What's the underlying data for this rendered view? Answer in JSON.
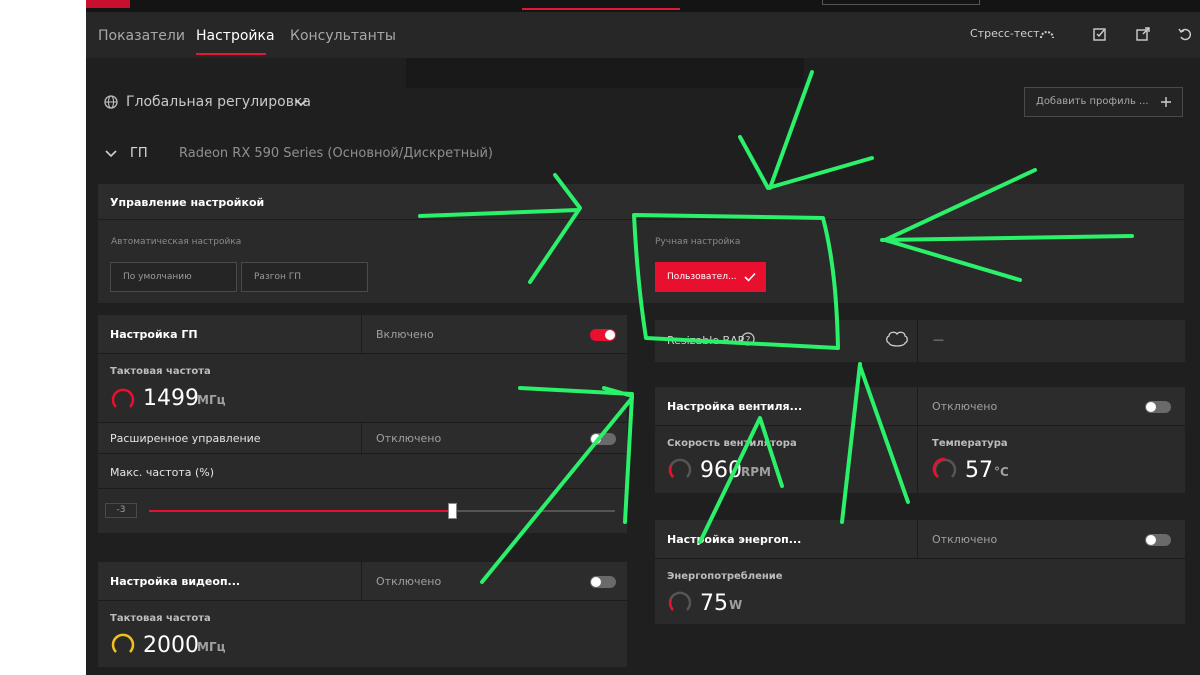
{
  "nav": {
    "tabs": [
      {
        "label": "Показатели"
      },
      {
        "label": "Настройка"
      },
      {
        "label": "Консультанты"
      }
    ],
    "stress_test": "Стресс-тест"
  },
  "global": {
    "label": "Глобальная регулировка",
    "add_profile": "Добавить профиль ..."
  },
  "gpu": {
    "section": "ГП",
    "name": "Radeon RX 590 Series (Основной/Дискретный)"
  },
  "tuning_control": {
    "title": "Управление настройкой",
    "auto_label": "Автоматическая настройка",
    "default_btn": "По умолчанию",
    "overclock_btn": "Разгон ГП",
    "manual_label": "Ручная настройка",
    "custom_btn": "Пользовател..."
  },
  "gpu_tuning": {
    "title": "Настройка ГП",
    "state": "Включено",
    "clock_label": "Тактовая частота",
    "clock_value": "1499",
    "clock_unit": "МГц",
    "advanced_label": "Расширенное управление",
    "advanced_state": "Отключено",
    "max_freq_label": "Макс. частота (%)",
    "max_freq_value": "-3",
    "max_freq_fraction": 0.65
  },
  "resizable_bar": {
    "label": "Resizable BAR",
    "value": "—"
  },
  "fan_tuning": {
    "title": "Настройка вентиля...",
    "state": "Отключено",
    "speed_label": "Скорость вентилятора",
    "speed_value": "960",
    "speed_unit": "RPM",
    "temp_label": "Температура",
    "temp_value": "57",
    "temp_unit": "°C"
  },
  "power_tuning": {
    "title": "Настройка энергоп...",
    "state": "Отключено",
    "power_label": "Энергопотребление",
    "power_value": "75",
    "power_unit": "W"
  },
  "vram_tuning": {
    "title": "Настройка видеоп...",
    "state": "Отключено",
    "clock_label": "Тактовая частота",
    "clock_value": "2000",
    "clock_unit": "МГц"
  },
  "colors": {
    "accent": "#e8102e",
    "annotation": "#2bf06a",
    "gauge_yellow": "#f2c21b"
  }
}
